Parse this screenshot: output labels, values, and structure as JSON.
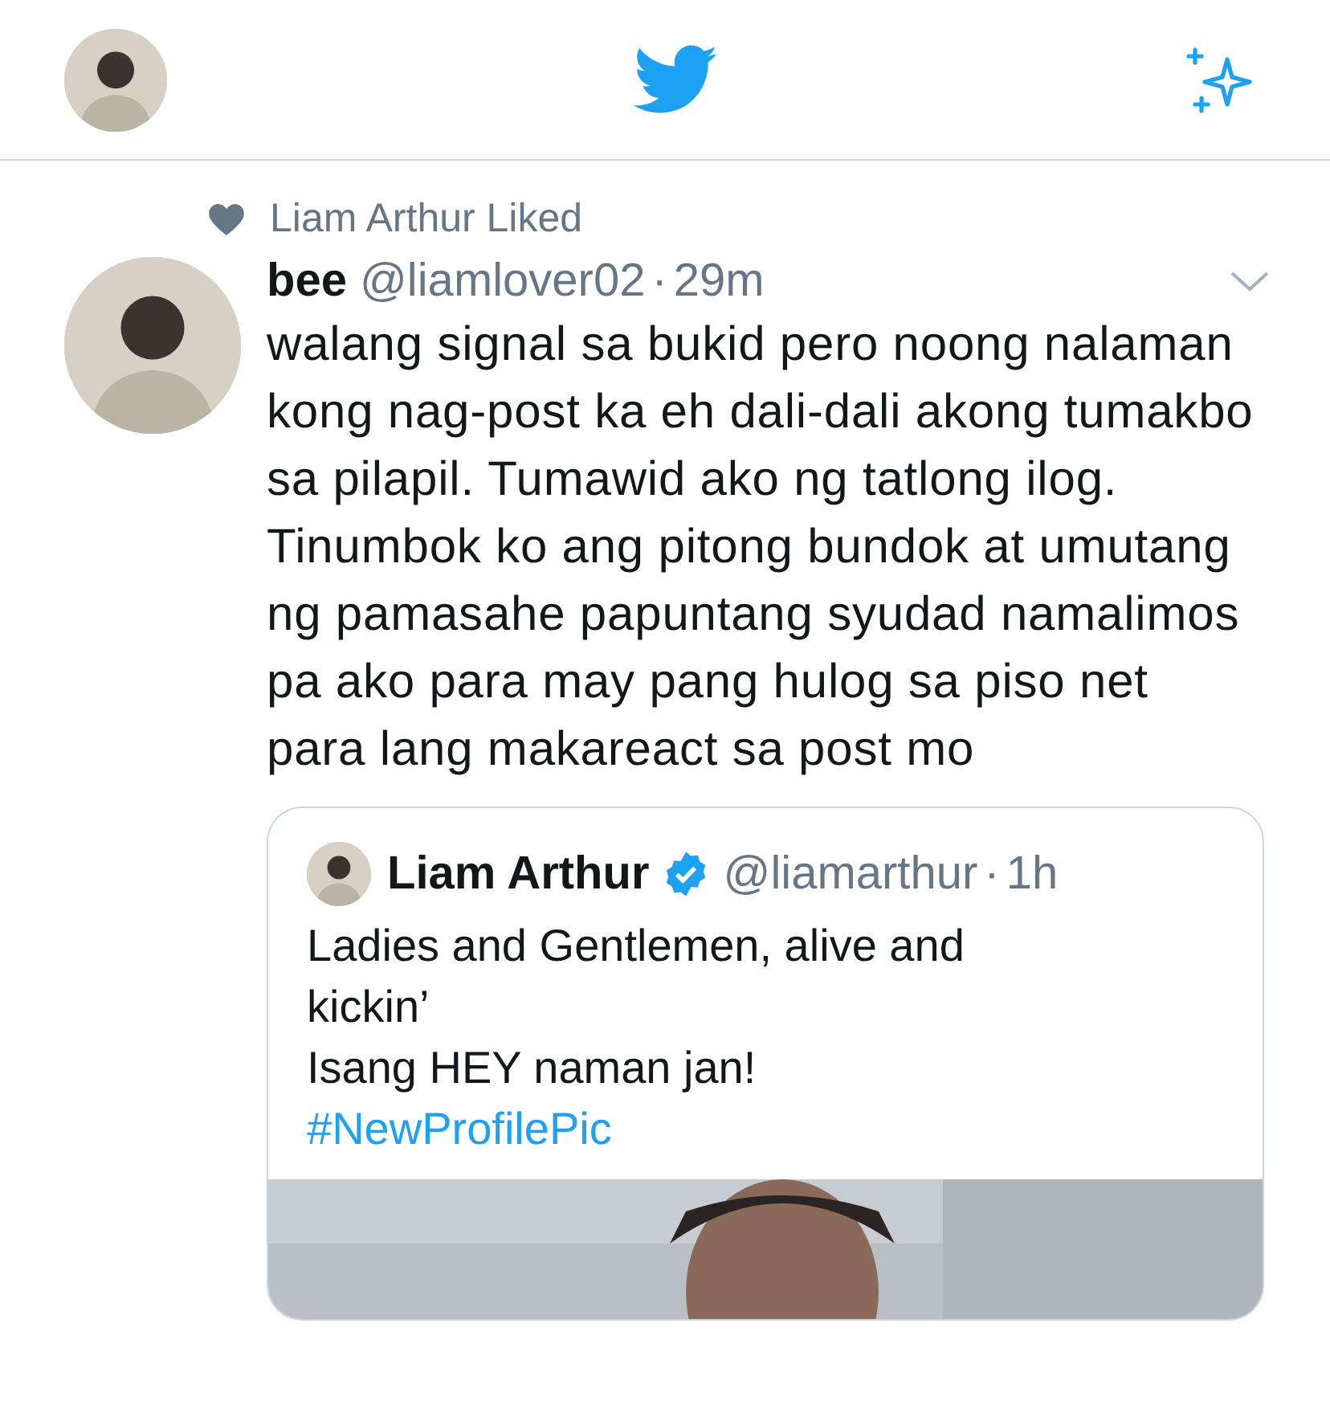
{
  "social_context": {
    "text": "Liam Arthur Liked"
  },
  "tweet": {
    "name": "bee",
    "handle": "@liamlover02",
    "separator": "·",
    "time": "29m",
    "text": "walang signal sa bukid pero noong nalaman kong nag-post ka eh dali-dali akong tumakbo sa pilapil. Tumawid ako ng tatlong ilog. Tinumbok ko ang pitong bundok at umutang ng pamasahe papuntang syudad namalimos pa ako para may pang hulog sa piso net para lang makareact sa post mo",
    "quote": {
      "name": "Liam Arthur",
      "verified": true,
      "handle": "@liamarthur",
      "separator": "·",
      "time": "1h",
      "lines": [
        "Ladies and Gentlemen, alive and kickin’",
        "Isang HEY naman jan!"
      ],
      "hashtag": "#NewProfilePic"
    }
  }
}
